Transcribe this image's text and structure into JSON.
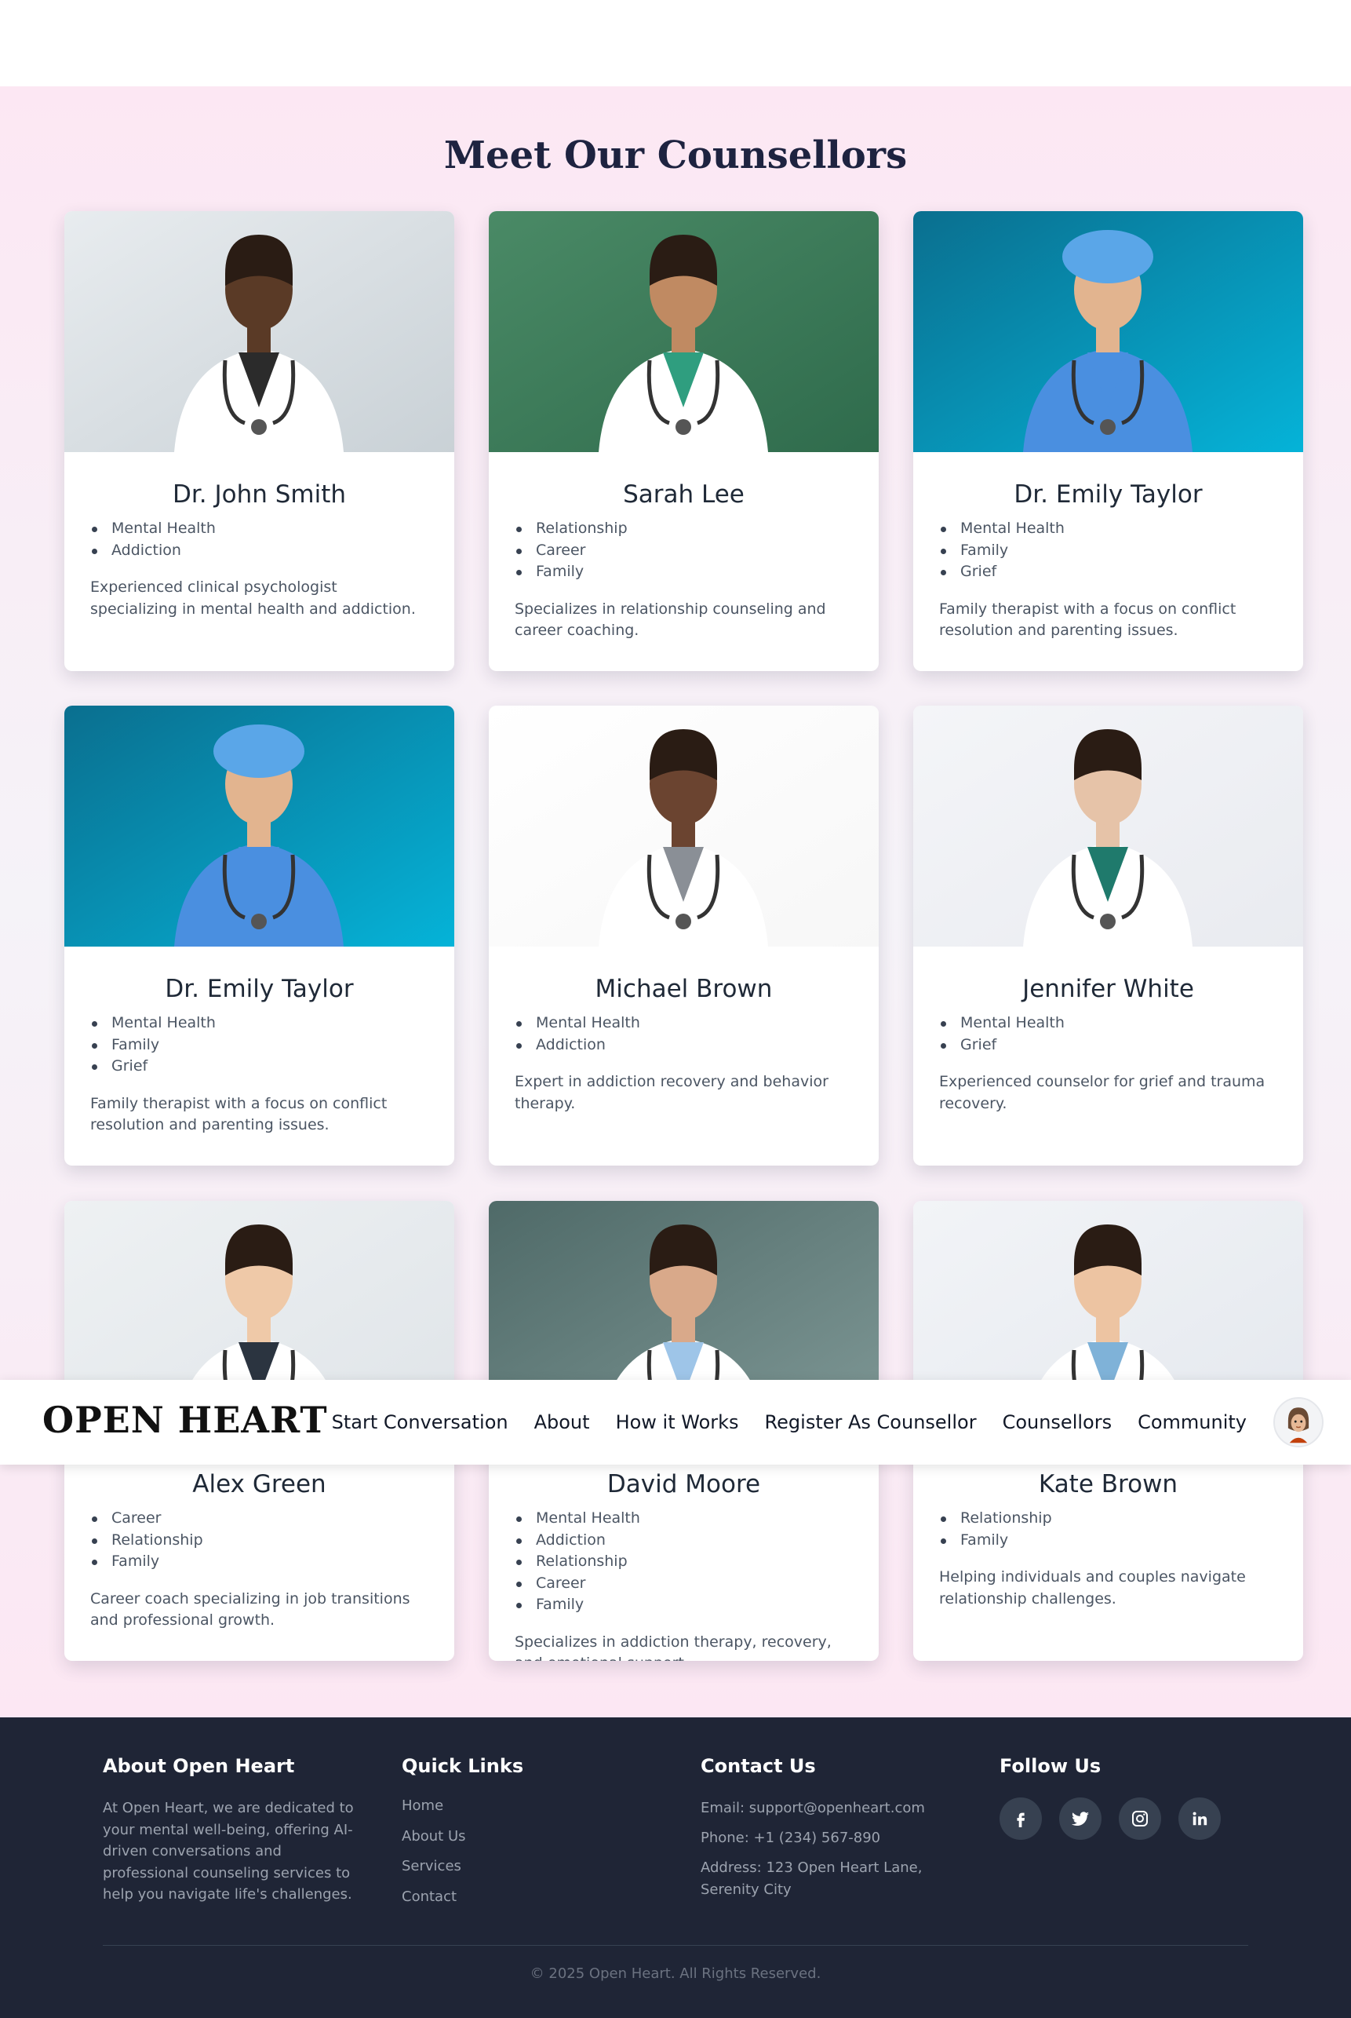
{
  "section": {
    "title": "Meet Our Counsellors"
  },
  "counsellors": [
    {
      "name": "Dr. John Smith",
      "specialties": [
        "Mental Health",
        "Addiction"
      ],
      "description": "Experienced clinical psychologist specializing in mental health and addiction."
    },
    {
      "name": "Sarah Lee",
      "specialties": [
        "Relationship",
        "Career",
        "Family"
      ],
      "description": "Specializes in relationship counseling and career coaching."
    },
    {
      "name": "Dr. Emily Taylor",
      "specialties": [
        "Mental Health",
        "Family",
        "Grief"
      ],
      "description": "Family therapist with a focus on conflict resolution and parenting issues."
    },
    {
      "name": "Dr. Emily Taylor",
      "specialties": [
        "Mental Health",
        "Family",
        "Grief"
      ],
      "description": "Family therapist with a focus on conflict resolution and parenting issues."
    },
    {
      "name": "Michael Brown",
      "specialties": [
        "Mental Health",
        "Addiction"
      ],
      "description": "Expert in addiction recovery and behavior therapy."
    },
    {
      "name": "Jennifer White",
      "specialties": [
        "Mental Health",
        "Grief"
      ],
      "description": "Experienced counselor for grief and trauma recovery."
    },
    {
      "name": "Alex Green",
      "specialties": [
        "Career",
        "Relationship",
        "Family"
      ],
      "description": "Career coach specializing in job transitions and professional growth."
    },
    {
      "name": "David Moore",
      "specialties": [
        "Mental Health",
        "Addiction",
        "Relationship",
        "Career",
        "Family"
      ],
      "description": "Specializes in addiction therapy, recovery, and emotional support."
    },
    {
      "name": "Kate Brown",
      "specialties": [
        "Relationship",
        "Family"
      ],
      "description": "Helping individuals and couples navigate relationship challenges."
    }
  ],
  "navbar": {
    "brand": "OPEN HEART",
    "links": [
      "Start Conversation",
      "About",
      "How it Works",
      "Register As Counsellor",
      "Counsellors",
      "Community"
    ],
    "avatar_icon": "user-avatar-icon"
  },
  "footer": {
    "about": {
      "heading": "About Open Heart",
      "text": "At Open Heart, we are dedicated to your mental well-being, offering AI-driven conversations and professional counseling services to help you navigate life's challenges."
    },
    "quick_links": {
      "heading": "Quick Links",
      "links": [
        "Home",
        "About Us",
        "Services",
        "Contact"
      ]
    },
    "contact": {
      "heading": "Contact Us",
      "email": "Email: support@openheart.com",
      "phone": "Phone: +1 (234) 567-890",
      "address": "Address: 123 Open Heart Lane, Serenity City"
    },
    "follow": {
      "heading": "Follow Us",
      "icons": [
        "facebook-icon",
        "twitter-icon",
        "instagram-icon",
        "linkedin-icon"
      ]
    },
    "copyright": "© 2025 Open Heart. All Rights Reserved."
  },
  "colors": {
    "title": "#1e2340",
    "footer_bg": "#1f2536",
    "section_bg": "#fce7f3",
    "social_bg": "#374151"
  }
}
